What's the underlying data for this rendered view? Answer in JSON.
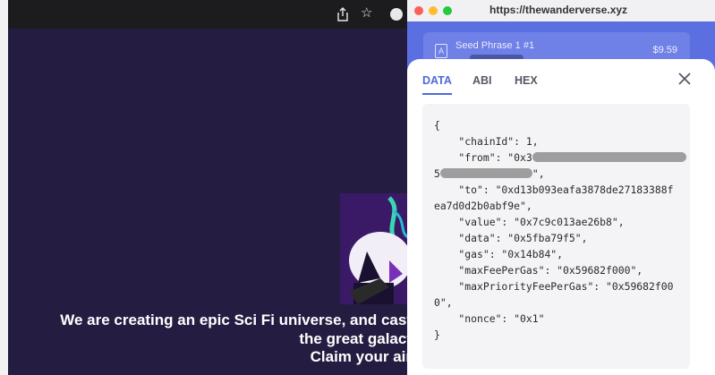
{
  "browser": {
    "share_icon": "share-icon",
    "star_icon": "star-icon"
  },
  "website": {
    "hero_lines": [
      "We are creating an epic Sci Fi universe, and cast",
      "the great galact",
      "Claim your air"
    ]
  },
  "popup": {
    "url": "https://thewanderverse.xyz",
    "summary": {
      "title": "Seed Phrase 1 #1",
      "subtitle": "0x",
      "price": "$9.59"
    },
    "tabs": [
      {
        "label": "DATA",
        "active": true
      },
      {
        "label": "ABI",
        "active": false
      },
      {
        "label": "HEX",
        "active": false
      }
    ],
    "json_lines": {
      "open": "{",
      "chain_id": "    \"chainId\": 1,",
      "from_start": "    \"from\": \"0x3",
      "from_cont_start": "5",
      "from_cont_end": "\",",
      "to_1": "    \"to\": \"0xd13b093eafa3878de27183388f",
      "to_2": "ea7d0d2b0abf9e\",",
      "value": "    \"value\": \"0x7c9c013ae26b8\",",
      "data": "    \"data\": \"0x5fba79f5\",",
      "gas": "    \"gas\": \"0x14b84\",",
      "max_fee": "    \"maxFeePerGas\": \"0x59682f000\",",
      "max_priority_1": "    \"maxPriorityFeePerGas\": \"0x59682f00",
      "max_priority_2": "0\",",
      "nonce": "    \"nonce\": \"0x1\"",
      "close": "}"
    }
  }
}
